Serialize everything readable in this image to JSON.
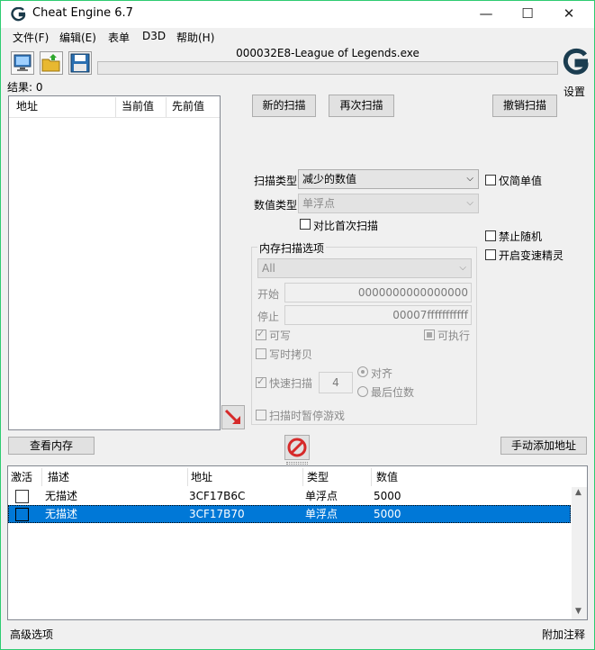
{
  "window": {
    "title": "Cheat Engine 6.7",
    "process_name": "000032E8-League of Legends.exe",
    "controls": {
      "minimize": "—",
      "maximize": "☐",
      "close": "✕"
    }
  },
  "menu": [
    "文件(F)",
    "编辑(E)",
    "表单",
    "D3D",
    "帮助(H)"
  ],
  "toolbar": {
    "icons": [
      "monitor-icon",
      "open-folder-icon",
      "save-disk-icon"
    ],
    "settings_label": "设置"
  },
  "results": {
    "label": "结果: 0",
    "columns": [
      "地址",
      "当前值",
      "先前值"
    ]
  },
  "scan_buttons": {
    "first_scan": "新的扫描",
    "next_scan": "再次扫描",
    "undo_scan": "撤销扫描"
  },
  "scan_options": {
    "scan_type_label": "扫描类型",
    "scan_type_value": "减少的数值",
    "value_type_label": "数值类型",
    "value_type_value": "单浮点",
    "compare_first": "对比首次扫描",
    "simple_values_only": "仅简单值",
    "disable_random": "禁止随机",
    "enable_speedhack": "开启变速精灵"
  },
  "memory_options": {
    "title": "内存扫描选项",
    "region_value": "All",
    "start_label": "开始",
    "start_value": "0000000000000000",
    "stop_label": "停止",
    "stop_value": "00007fffffffffff",
    "writable": "可写",
    "executable": "可执行",
    "copy_on_write": "写时拷贝",
    "fast_scan": "快速扫描",
    "fast_scan_value": "4",
    "align": "对齐",
    "last_digits": "最后位数",
    "pause_game": "扫描时暂停游戏"
  },
  "bottom_buttons": {
    "memory_view": "查看内存",
    "add_address": "手动添加地址"
  },
  "address_list": {
    "columns": [
      "激活",
      "描述",
      "地址",
      "类型",
      "数值"
    ],
    "rows": [
      {
        "active": "",
        "description": "无描述",
        "address": "3CF17B6C",
        "type": "单浮点",
        "value": "5000",
        "selected": false
      },
      {
        "active": "",
        "description": "无描述",
        "address": "3CF17B70",
        "type": "单浮点",
        "value": "5000",
        "selected": true
      }
    ]
  },
  "status_bar": {
    "advanced": "高级选项",
    "comments": "附加注释"
  },
  "colors": {
    "selection": "#0078d7",
    "window_border": "#2ecc71",
    "arrow": "#d62a2a",
    "stop": "#d62a2a"
  }
}
